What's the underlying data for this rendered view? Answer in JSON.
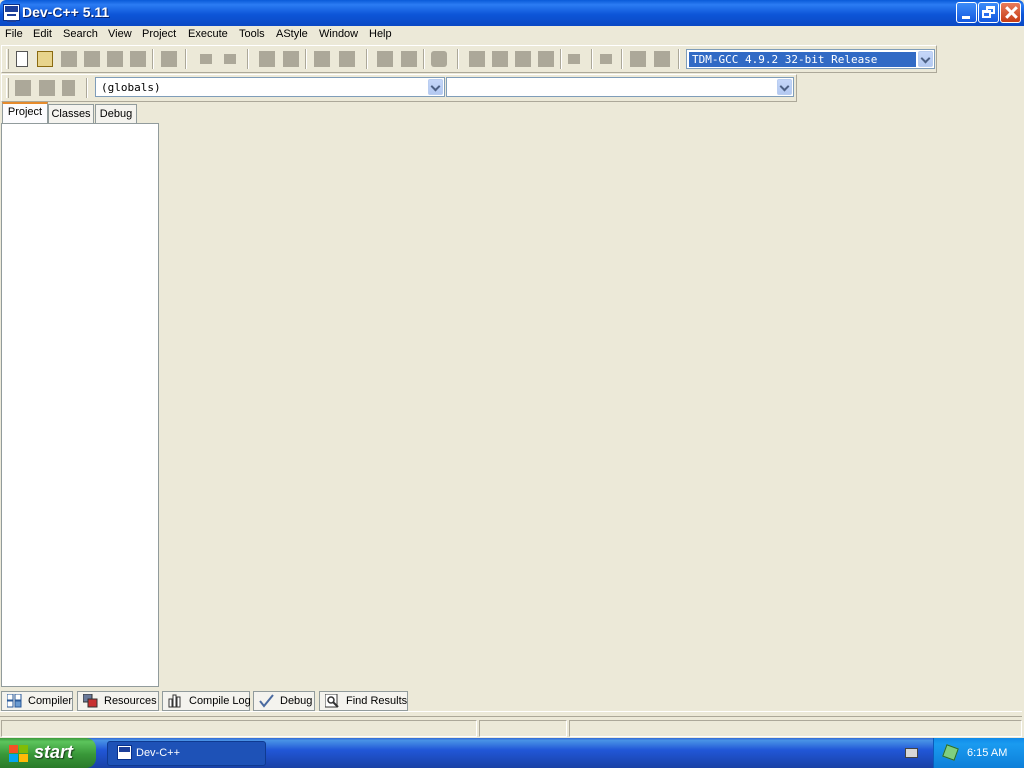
{
  "window": {
    "title": "Dev-C++ 5.11",
    "app_icon": "devcpp-app-icon",
    "controls": [
      "minimize-icon",
      "restore-icon",
      "close-icon"
    ]
  },
  "menu": {
    "items": [
      {
        "label": "File"
      },
      {
        "label": "Edit"
      },
      {
        "label": "Search"
      },
      {
        "label": "View"
      },
      {
        "label": "Project"
      },
      {
        "label": "Execute"
      },
      {
        "label": "Tools"
      },
      {
        "label": "AStyle"
      },
      {
        "label": "Window"
      },
      {
        "label": "Help"
      }
    ]
  },
  "toolbar": {
    "compiler_select": {
      "value": "TDM-GCC 4.9.2 32-bit Release"
    },
    "globals_select": {
      "value": "(globals)"
    },
    "member_select": {
      "value": ""
    }
  },
  "left_panel": {
    "tabs": [
      {
        "label": "Project",
        "active": true
      },
      {
        "label": "Classes",
        "active": false
      },
      {
        "label": "Debug",
        "active": false
      }
    ]
  },
  "bottom_tabs": [
    {
      "label": "Compiler",
      "icon": "compiler-grid-icon"
    },
    {
      "label": "Resources",
      "icon": "resources-icon"
    },
    {
      "label": "Compile Log",
      "icon": "compile-log-chart-icon"
    },
    {
      "label": "Debug",
      "icon": "debug-checkmark-icon"
    },
    {
      "label": "Find Results",
      "icon": "find-results-magnifier-icon"
    }
  ],
  "taskbar": {
    "start_label": "start",
    "task_label": "Dev-C++",
    "clock": "6:15 AM"
  },
  "colors": {
    "titlebar": "#0a56d8",
    "window_bg": "#ece9d8",
    "selection": "#316ac5",
    "start_green": "#3c9a3c",
    "taskbar_blue": "#2157d7"
  }
}
